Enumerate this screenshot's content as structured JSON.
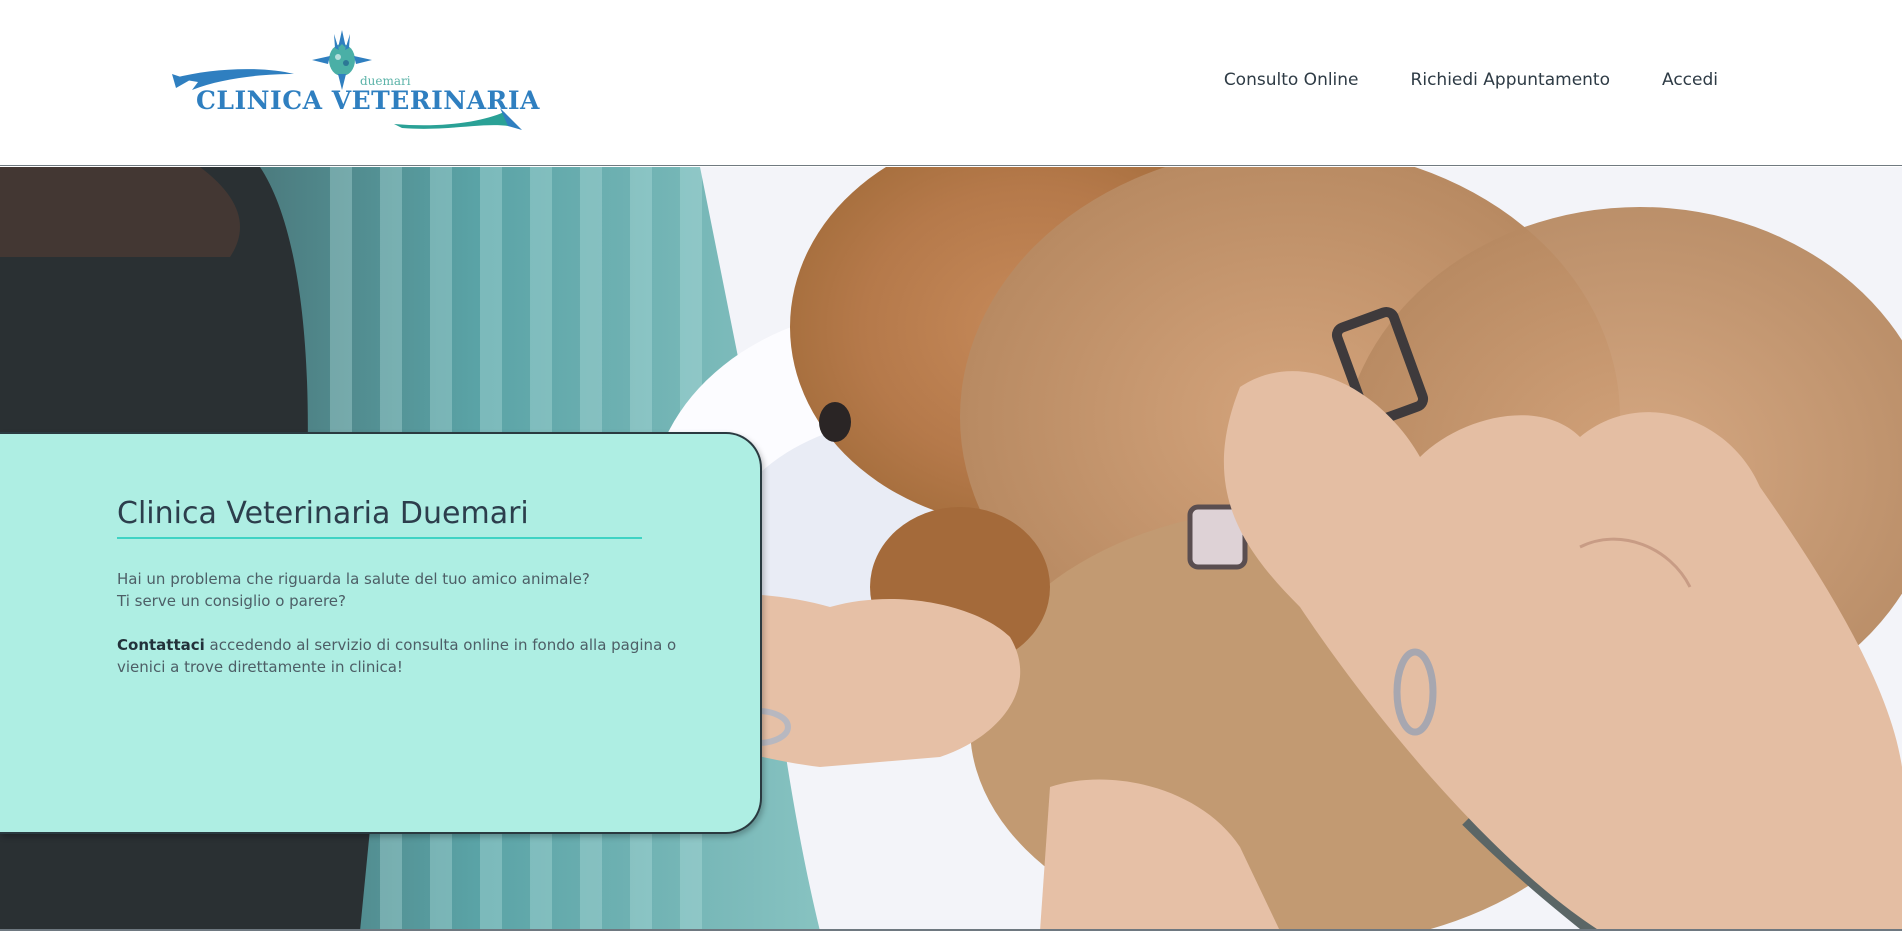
{
  "header": {
    "logo": {
      "text": "CLINICA VETERINARIA",
      "subtext": "duemari",
      "colors": {
        "blue": "#2f7fc0",
        "teal": "#2aa196"
      }
    },
    "nav": [
      {
        "label": "Consulto Online"
      },
      {
        "label": "Richiedi Appuntamento"
      },
      {
        "label": "Accedi"
      }
    ]
  },
  "hero": {
    "card": {
      "title": "Clinica Veterinaria Duemari",
      "line1": "Hai un problema che riguarda la salute del tuo amico animale?",
      "line2": "Ti serve un consiglio o parere?",
      "contact_bold": "Contattaci",
      "contact_rest": " accedendo al servizio di consulta online in fondo alla pagina o",
      "contact_line2": "vienici a trove direttamente in clinica!"
    },
    "colors": {
      "card_bg": "#aeeee3",
      "accent": "#3ed3c4"
    }
  }
}
